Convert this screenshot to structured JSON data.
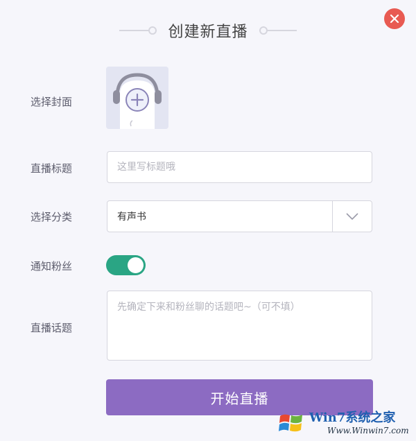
{
  "window": {
    "title": "创建新直播"
  },
  "form": {
    "cover_label": "选择封面",
    "title_label": "直播标题",
    "title_placeholder": "这里写标题哦",
    "category_label": "选择分类",
    "category_value": "有声书",
    "notify_label": "通知粉丝",
    "notify_on": true,
    "topic_label": "直播话题",
    "topic_placeholder": "先确定下来和粉丝聊的话题吧~（可不填）"
  },
  "actions": {
    "start_label": "开始直播"
  },
  "colors": {
    "accent": "#8c6bc2",
    "toggle_on": "#2aa584",
    "close": "#e85a52"
  },
  "watermark": {
    "brand": "Win7系统之家",
    "url": "Www.Winwin7.com"
  }
}
